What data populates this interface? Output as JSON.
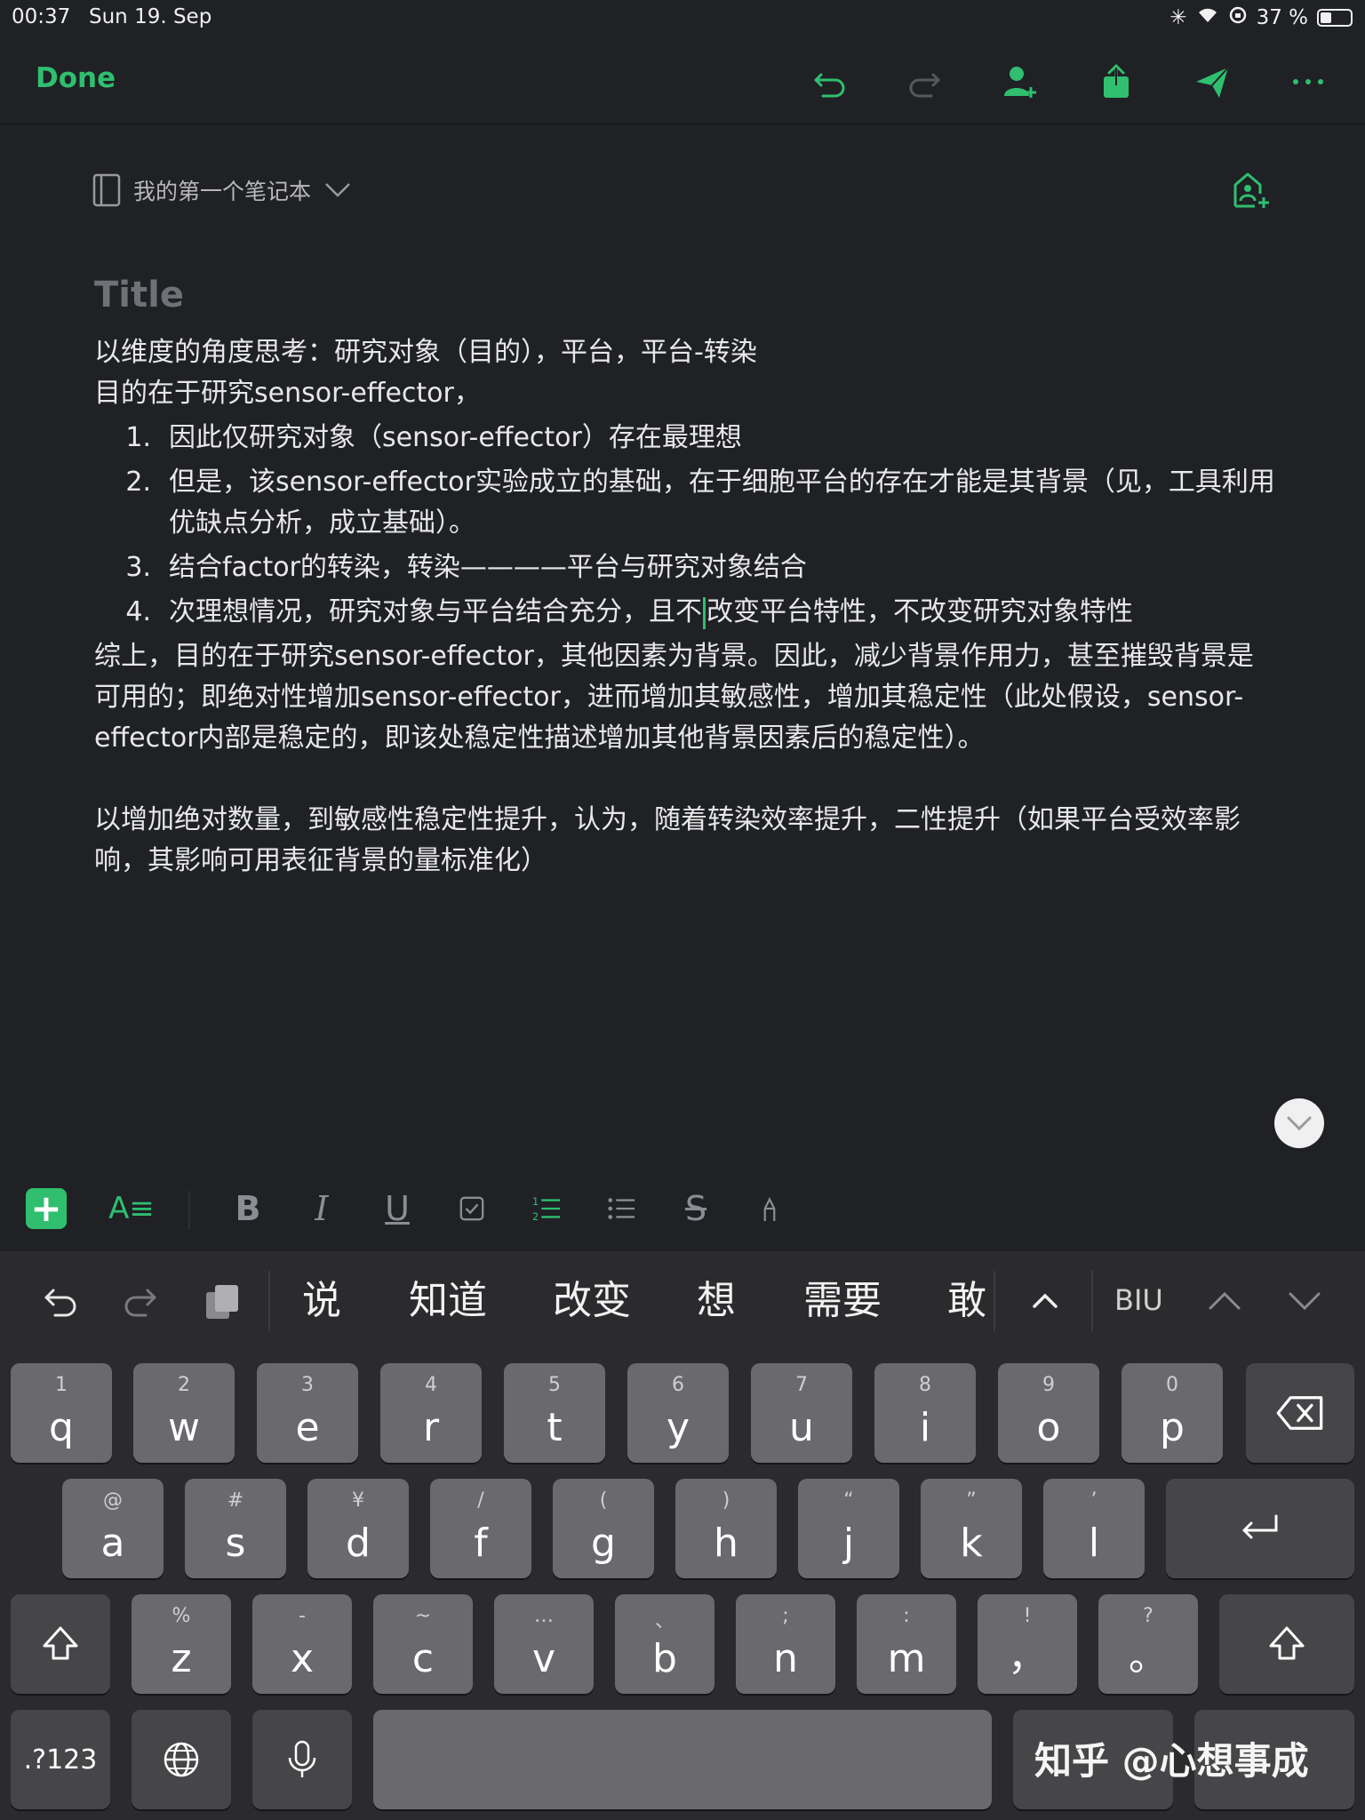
{
  "status": {
    "time": "00:37",
    "date": "Sun 19. Sep",
    "battery": "37 %"
  },
  "toolbar": {
    "done_label": "Done"
  },
  "note": {
    "notebook": "我的第一个笔记本",
    "title_placeholder": "Title",
    "line1": "以维度的角度思考：研究对象（目的），平台，平台-转染",
    "line2": "目的在于研究sensor-effector，",
    "list": [
      {
        "num": "1.",
        "text": "因此仅研究对象（sensor-effector）存在最理想"
      },
      {
        "num": "2.",
        "text": "但是，该sensor-effector实验成立的基础，在于细胞平台的存在才能是其背景（见，工具利用优缺点分析，成立基础）。"
      },
      {
        "num": "3.",
        "text": "结合factor的转染，转染————平台与研究对象结合"
      }
    ],
    "item4_num": "4.",
    "item4_before": "次理想情况，研究对象与平台结合充分，且不",
    "item4_after": "改变平台特性，不改变研究对象特性",
    "summary": "综上，目的在于研究sensor-effector，其他因素为背景。因此，减少背景作用力，甚至摧毁背景是可用的；即绝对性增加sensor-effector，进而增加其敏感性，增加其稳定性（此处假设，sensor-effector内部是稳定的，即该处稳定性描述增加其他背景因素后的稳定性）。",
    "final": "以增加绝对数量，到敏感性稳定性提升，认为，随着转染效率提升，二性提升（如果平台受效率影响，其影响可用表征背景的量标准化）"
  },
  "keyboard": {
    "candidates": [
      "说",
      "知道",
      "改变",
      "想",
      "需要",
      "敢"
    ],
    "biu_label": "BIU",
    "row1": [
      {
        "hint": "1",
        "key": "q"
      },
      {
        "hint": "2",
        "key": "w"
      },
      {
        "hint": "3",
        "key": "e"
      },
      {
        "hint": "4",
        "key": "r"
      },
      {
        "hint": "5",
        "key": "t"
      },
      {
        "hint": "6",
        "key": "y"
      },
      {
        "hint": "7",
        "key": "u"
      },
      {
        "hint": "8",
        "key": "i"
      },
      {
        "hint": "9",
        "key": "o"
      },
      {
        "hint": "0",
        "key": "p"
      }
    ],
    "row2": [
      {
        "hint": "@",
        "key": "a"
      },
      {
        "hint": "#",
        "key": "s"
      },
      {
        "hint": "¥",
        "key": "d"
      },
      {
        "hint": "/",
        "key": "f"
      },
      {
        "hint": "(",
        "key": "g"
      },
      {
        "hint": ")",
        "key": "h"
      },
      {
        "hint": "“",
        "key": "j"
      },
      {
        "hint": "”",
        "key": "k"
      },
      {
        "hint": "’",
        "key": "l"
      }
    ],
    "row3": [
      {
        "hint": "%",
        "key": "z"
      },
      {
        "hint": "-",
        "key": "x"
      },
      {
        "hint": "~",
        "key": "c"
      },
      {
        "hint": "…",
        "key": "v"
      },
      {
        "hint": "、",
        "key": "b"
      },
      {
        "hint": ";",
        "key": "n"
      },
      {
        "hint": ":",
        "key": "m"
      },
      {
        "hint": "!",
        "key": "，"
      },
      {
        "hint": "?",
        "key": "。"
      }
    ],
    "numbers_label": ".?123"
  },
  "watermark": "知乎 @心想事成",
  "colors": {
    "accent": "#2fbf6f",
    "background": "#1f2125",
    "keyboard": "#2b2b2e"
  }
}
